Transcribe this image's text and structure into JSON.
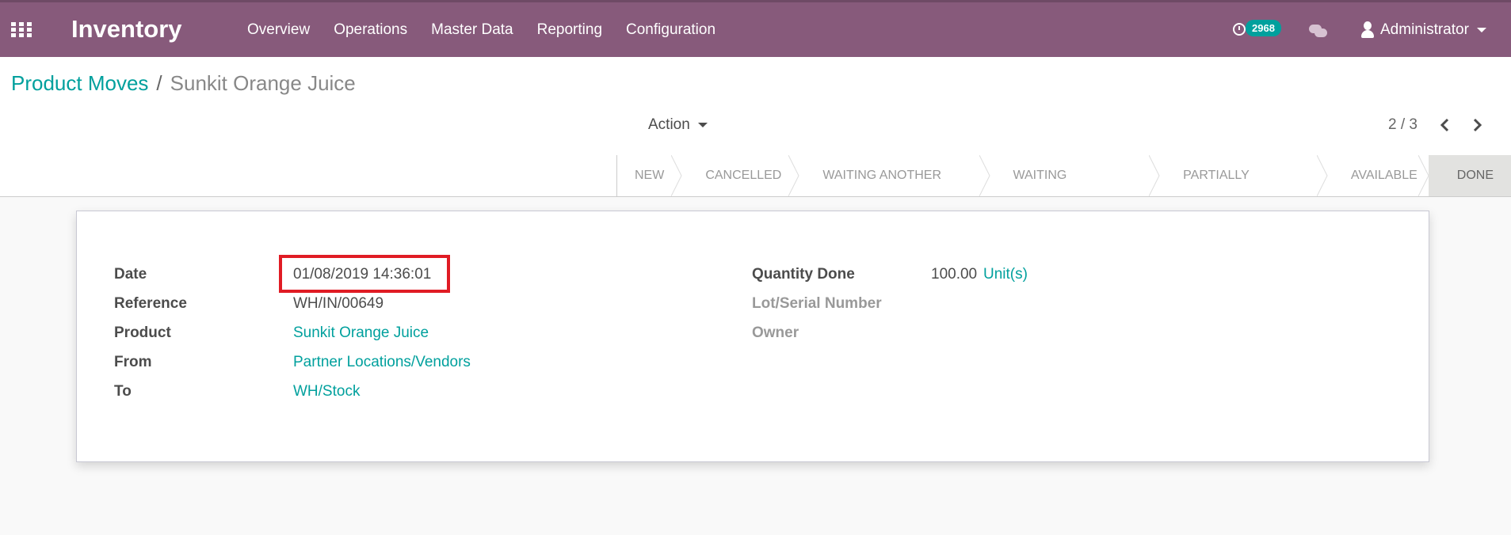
{
  "navbar": {
    "app_name": "Inventory",
    "menu": [
      "Overview",
      "Operations",
      "Master Data",
      "Reporting",
      "Configuration"
    ],
    "activity_count": "2968",
    "user": "Administrator",
    "color": "#875a7b"
  },
  "breadcrumb": {
    "parent": "Product Moves",
    "separator": "/",
    "current": "Sunkit Orange Juice"
  },
  "toolbar": {
    "action_label": "Action",
    "pager": "2 / 3"
  },
  "status": {
    "stages": [
      "NEW",
      "CANCELLED",
      "WAITING ANOTHER MOVE",
      "WAITING AVAILABILITY",
      "PARTIALLY AVAILABLE",
      "AVAILABLE",
      "DONE"
    ],
    "current": "DONE"
  },
  "form": {
    "left": [
      {
        "label": "Date",
        "value": "01/08/2019 14:36:01"
      },
      {
        "label": "Reference",
        "value": "WH/IN/00649"
      },
      {
        "label": "Product",
        "value": "Sunkit Orange Juice"
      },
      {
        "label": "From",
        "value": "Partner Locations/Vendors"
      },
      {
        "label": "To",
        "value": "WH/Stock"
      }
    ],
    "right": [
      {
        "label": "Quantity Done",
        "value": "100.00",
        "unit": "Unit(s)"
      },
      {
        "label": "Lot/Serial Number",
        "value": ""
      },
      {
        "label": "Owner",
        "value": ""
      }
    ]
  },
  "colors": {
    "link": "#00a09d",
    "highlight": "#e01b24"
  }
}
